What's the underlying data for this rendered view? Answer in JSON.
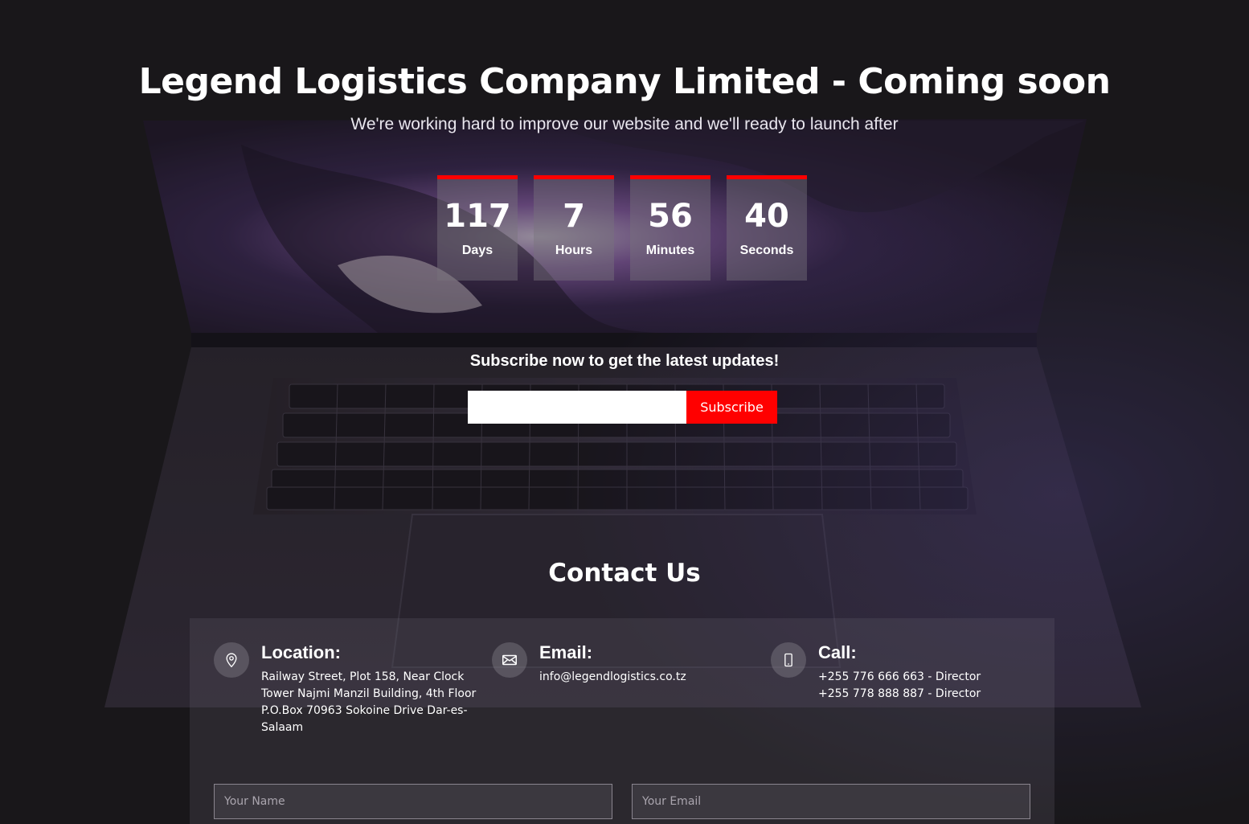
{
  "header": {
    "title": "Legend Logistics Company Limited - Coming soon",
    "subtitle": "We're working hard to improve our website and we'll ready to launch after"
  },
  "countdown": [
    {
      "value": "117",
      "label": "Days"
    },
    {
      "value": "7",
      "label": "Hours"
    },
    {
      "value": "56",
      "label": "Minutes"
    },
    {
      "value": "40",
      "label": "Seconds"
    }
  ],
  "subscribe": {
    "heading": "Subscribe now to get the latest updates!",
    "input_value": "",
    "button_label": "Subscribe"
  },
  "contact": {
    "heading": "Contact Us",
    "location": {
      "icon": "map-pin-icon",
      "title": "Location:",
      "lines": [
        "Railway Street, Plot 158, Near Clock",
        "Tower Najmi Manzil Building, 4th Floor",
        "P.O.Box 70963 Sokoine Drive Dar-es-",
        "Salaam"
      ]
    },
    "email": {
      "icon": "envelope-icon",
      "title": "Email:",
      "lines": [
        "info@legendlogistics.co.tz"
      ]
    },
    "call": {
      "icon": "mobile-phone-icon",
      "title": "Call:",
      "lines": [
        "+255 776 666 663 - Director",
        "+255 778 888 887 - Director"
      ]
    },
    "form": {
      "name_placeholder": "Your Name",
      "email_placeholder": "Your Email"
    }
  },
  "colors": {
    "accent": "#ff0000",
    "background": "#1c1b1d",
    "text": "#ffffff"
  }
}
